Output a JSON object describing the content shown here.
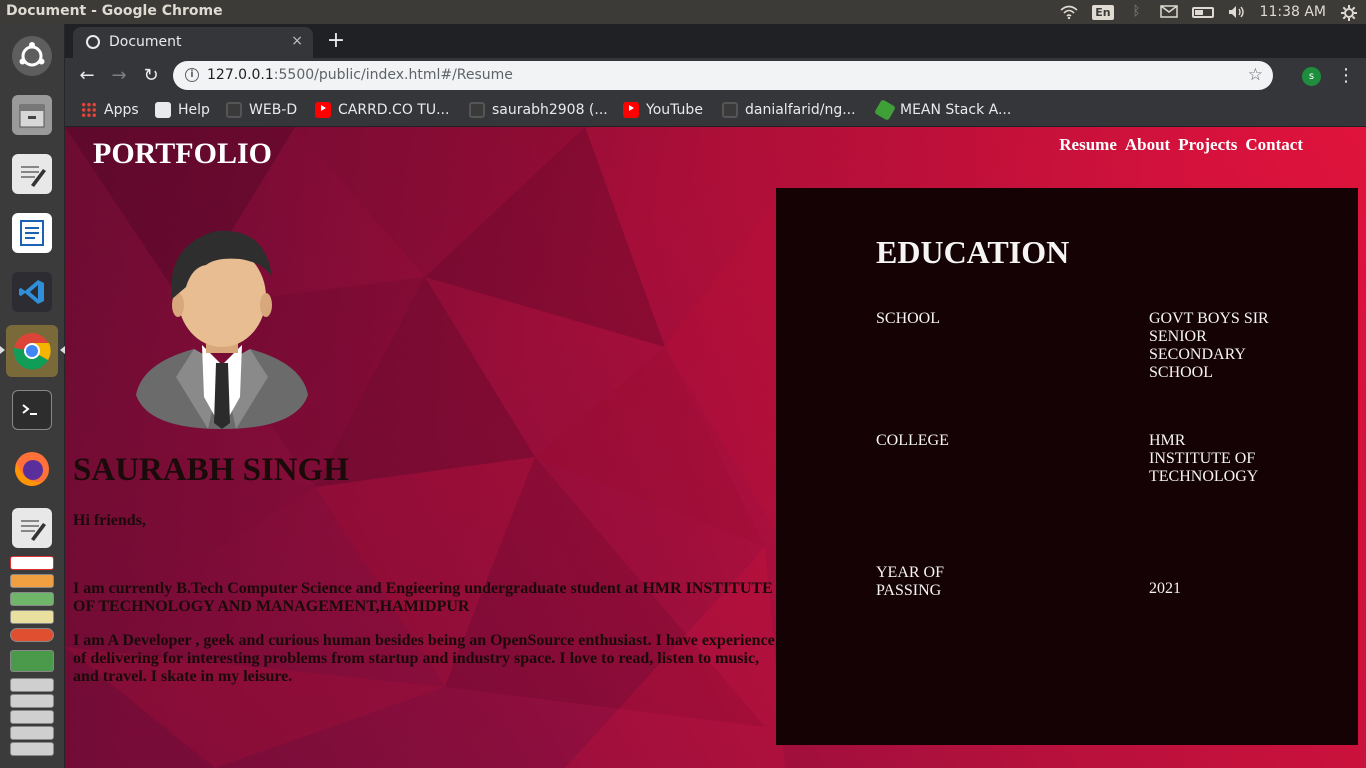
{
  "os": {
    "window_title": "Document - Google Chrome",
    "keyboard_layout": "En",
    "clock": "11:38 AM",
    "tray_icons": [
      "wifi-icon",
      "keyboard-layout-icon",
      "bluetooth-icon",
      "mail-icon",
      "battery-icon",
      "volume-icon",
      "power-gear-icon"
    ]
  },
  "launcher": {
    "items": [
      "ubuntu-dash",
      "files",
      "text-editor",
      "libreoffice-writer",
      "vscode",
      "google-chrome",
      "terminal",
      "firefox",
      "text-editor-2",
      "document-stack"
    ]
  },
  "browser": {
    "tab": {
      "title": "Document",
      "close": "×"
    },
    "new_tab": "+",
    "back": "←",
    "forward": "→",
    "reload": "↻",
    "url_host": "127.0.0.1",
    "url_rest": ":5500/public/index.html#/Resume",
    "bookmark_star": "☆",
    "profile_initial": "s",
    "menu": "⋮",
    "bookmarks": [
      {
        "label": "Apps",
        "icon": "apps-grid-icon"
      },
      {
        "label": "Help",
        "icon": "globe-icon"
      },
      {
        "label": "WEB-D",
        "icon": "github-icon"
      },
      {
        "label": "CARRD.CO TU...",
        "icon": "youtube-icon"
      },
      {
        "label": "saurabh2908 (...",
        "icon": "github-icon"
      },
      {
        "label": "YouTube",
        "icon": "youtube-icon"
      },
      {
        "label": "danialfarid/ng...",
        "icon": "github-icon"
      },
      {
        "label": "MEAN Stack A...",
        "icon": "leaf-icon"
      }
    ]
  },
  "page": {
    "brand": "PORTFOLIO",
    "nav": [
      "Resume",
      "About",
      "Projects",
      "Contact"
    ],
    "name": "SAURABH SINGH",
    "greeting": "Hi friends,",
    "bio_1": "I am currently B.Tech Computer Science and Engieering undergraduate student at HMR INSTITUTE OF TECHNOLOGY AND MANAGEMENT,HAMIDPUR",
    "bio_2": "I am A Developer , geek and curious human besides being an OpenSource enthusiast. I have experience of delivering for interesting problems from startup and industry space. I love to read, listen to music, and travel. I skate in my leisure.",
    "education": {
      "title": "EDUCATION",
      "rows": [
        {
          "key": "SCHOOL",
          "value": "GOVT BOYS SIR SENIOR SECONDARY SCHOOL"
        },
        {
          "key": "COLLEGE",
          "value": "HMR INSTITUTE OF TECHNOLOGY"
        },
        {
          "key": "YEAR OF PASSING",
          "value": "2021"
        }
      ]
    }
  }
}
